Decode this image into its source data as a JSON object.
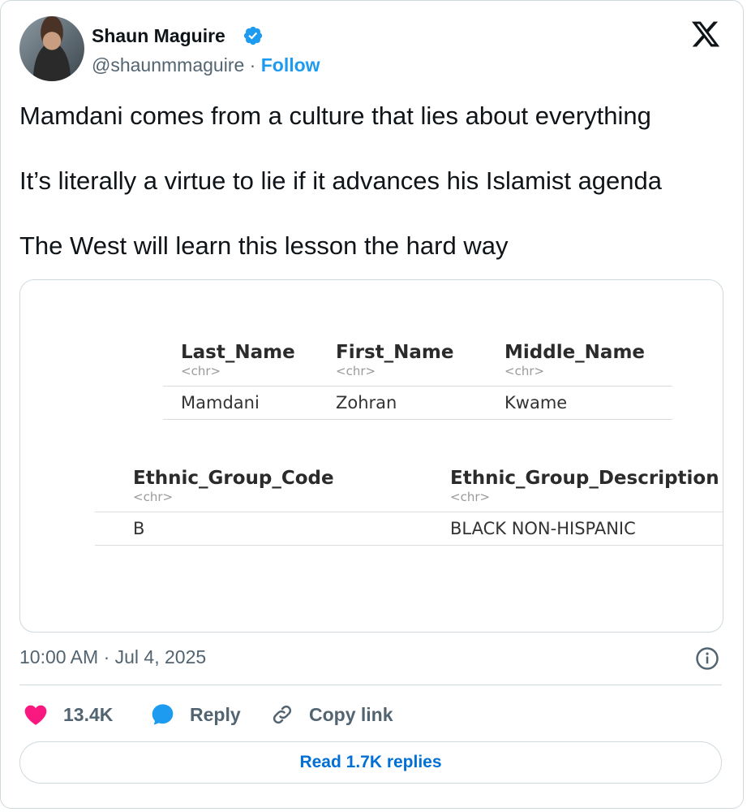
{
  "author": {
    "name": "Shaun Maguire",
    "handle": "@shaunmmaguire",
    "separator": "·",
    "follow_label": "Follow",
    "verified_color": "#1d9bf0"
  },
  "tweet": {
    "lines": [
      "Mamdani comes from a culture that lies about everything",
      "It’s literally a virtue to lie if it advances his Islamist agenda",
      "The West will learn this lesson the hard way"
    ]
  },
  "media": {
    "table1": {
      "headers": [
        "Last_Name",
        "First_Name",
        "Middle_Name"
      ],
      "types": [
        "<chr>",
        "<chr>",
        "<chr>"
      ],
      "row": [
        "Mamdani",
        "Zohran",
        "Kwame"
      ]
    },
    "table2": {
      "headers": [
        "Ethnic_Group_Code",
        "Ethnic_Group_Description"
      ],
      "types": [
        "<chr>",
        "<chr>"
      ],
      "row": [
        "B",
        "BLACK NON-HISPANIC"
      ]
    }
  },
  "meta": {
    "timestamp": "10:00 AM · Jul 4, 2025"
  },
  "actions": {
    "likes": "13.4K",
    "reply_label": "Reply",
    "copy_link_label": "Copy link",
    "like_color": "#f91880",
    "reply_color": "#1d9bf0"
  },
  "read_replies_label": "Read 1.7K replies"
}
